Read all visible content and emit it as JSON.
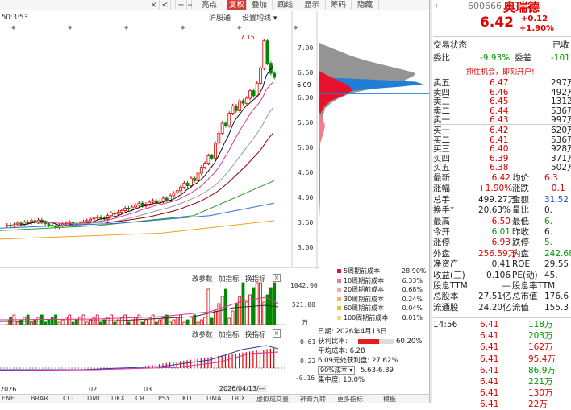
{
  "toolbar": {
    "buttons": [
      "×",
      "<",
      "|",
      "+",
      "−",
      "亮点",
      "复权",
      "叠加",
      "画线",
      "显示",
      "筹码",
      "隐藏"
    ],
    "active": "复权"
  },
  "chart_top": {
    "info": "50:3:53",
    "zt_label": "沪股通",
    "indicator_menu": "设置均线",
    "peak_label": "7.15"
  },
  "kline_ylabels": [
    "7.00",
    "6.50",
    "6.09",
    "6.00",
    "5.50",
    "5.00",
    "4.50",
    "4.00",
    "3.50",
    "3.00"
  ],
  "price_tag": "6.09",
  "chip_legend": [
    {
      "label": "5周期前成本",
      "pct": "28.90%",
      "color": "#e8112d"
    },
    {
      "label": "10周期前成本",
      "pct": "6.33%",
      "color": "#f27b8c"
    },
    {
      "label": "20周期前成本",
      "pct": "0.68%",
      "color": "#f7a8b4"
    },
    {
      "label": "30周期前成本",
      "pct": "0.24%",
      "color": "#f7b25a"
    },
    {
      "label": "60周期前成本",
      "pct": "0.04%",
      "color": "#e9c230"
    },
    {
      "label": "100周期前成本",
      "pct": "0.01%",
      "color": "#f0d88a"
    }
  ],
  "chip_info": {
    "date": "日期: 2026年4月13日",
    "profit_label": "获利比率:",
    "profit_value": "60.20%",
    "avg_cost": "平均成本: 6.28",
    "profit_at": "6.09元处获利盘: 27.62%",
    "cost_range_select": "90%成本",
    "cost_range": "5.63-6.89",
    "concentration": "集中度: 10.0%"
  },
  "vol_panel": {
    "params": "改参数",
    "add": "加指标",
    "switch": "换指标",
    "ylabels": [
      "1042.00",
      "521.00",
      "万"
    ]
  },
  "macd_panel": {
    "params": "改参数",
    "add": "加指标",
    "switch": "换指标",
    "ylabels": [
      "0.61",
      "0.22",
      "-0.16"
    ]
  },
  "bottom_axis": [
    "2026",
    "02",
    "03",
    "2026/04/13/—"
  ],
  "bottom_tabs": [
    "ENE",
    "BRAR",
    "CCI",
    "DMI",
    "DKX",
    "CR",
    "PSY",
    "KD",
    "DMA",
    "TRIX",
    "虚拟成交量",
    "神奇九转",
    "更多指标",
    "模板"
  ],
  "quote": {
    "code": "600666",
    "name": "奥瑞德",
    "price": "6.42",
    "change": "+0.12",
    "pct": "+1.90%",
    "trade_status_label": "交易状态",
    "trade_status": "已收",
    "weibi_label": "委比",
    "weibi": "-9.93%",
    "weicha_label": "委差",
    "weicha": "-101",
    "promo": "抓住机会，即刻开户!",
    "asks": [
      {
        "label": "卖五",
        "price": "6.47",
        "vol": "297万"
      },
      {
        "label": "卖四",
        "price": "6.46",
        "vol": "492万"
      },
      {
        "label": "卖三",
        "price": "6.45",
        "vol": "1312万"
      },
      {
        "label": "卖二",
        "price": "6.44",
        "vol": "536万"
      },
      {
        "label": "卖一",
        "price": "6.43",
        "vol": "997万"
      }
    ],
    "bids": [
      {
        "label": "买一",
        "price": "6.42",
        "vol": "620万"
      },
      {
        "label": "买二",
        "price": "6.41",
        "vol": "536万"
      },
      {
        "label": "买三",
        "price": "6.40",
        "vol": "928万"
      },
      {
        "label": "买四",
        "price": "6.39",
        "vol": "371万"
      },
      {
        "label": "买五",
        "price": "6.38",
        "vol": "502万"
      }
    ],
    "stats": [
      {
        "l1": "最新",
        "v1": "6.42",
        "c1": "red",
        "l2": "均价",
        "v2": "6.3",
        "c2": "red"
      },
      {
        "l1": "涨幅",
        "v1": "+1.90%",
        "c1": "red",
        "l2": "涨跌",
        "v2": "+0.1",
        "c2": "red"
      },
      {
        "l1": "总手",
        "v1": "499.27万",
        "c1": "",
        "l2": "金额",
        "v2": "31.52",
        "c2": "blue"
      },
      {
        "l1": "换手*",
        "v1": "20.63%",
        "c1": "",
        "l2": "量比",
        "v2": "0.",
        "c2": ""
      },
      {
        "l1": "最高",
        "v1": "6.50",
        "c1": "red",
        "l2": "最低",
        "v2": "6.",
        "c2": "green"
      },
      {
        "l1": "今开",
        "v1": "6.01",
        "c1": "green",
        "l2": "昨收",
        "v2": "6.",
        "c2": ""
      },
      {
        "l1": "涨停",
        "v1": "6.93",
        "c1": "red",
        "l2": "跌停",
        "v2": "5.",
        "c2": "green"
      },
      {
        "l1": "外盘",
        "v1": "256.59万",
        "c1": "red",
        "l2": "内盘",
        "v2": "242.68",
        "c2": "green"
      },
      {
        "l1": "净资产",
        "v1": "0.41",
        "c1": "",
        "l2": "ROE",
        "v2": "29.55",
        "c2": ""
      },
      {
        "l1": "收益(三)",
        "v1": "0.106",
        "c1": "",
        "l2": "PE(动)",
        "v2": "45.",
        "c2": ""
      },
      {
        "l1": "股息TTM",
        "v1": "—",
        "c1": "",
        "l2": "股息率TTM",
        "v2": "",
        "c2": ""
      },
      {
        "l1": "总股本",
        "v1": "27.51亿",
        "c1": "",
        "l2": "总市值",
        "v2": "176.6",
        "c2": ""
      },
      {
        "l1": "流通股",
        "v1": "24.20亿",
        "c1": "",
        "l2": "流值",
        "v2": "155.3",
        "c2": ""
      }
    ],
    "tape": [
      {
        "time": "14:56",
        "price": "6.41",
        "vol": "118万",
        "c": "green"
      },
      {
        "time": "",
        "price": "6.41",
        "vol": "203万",
        "c": "green"
      },
      {
        "time": "",
        "price": "6.41",
        "vol": "162万",
        "c": "red"
      },
      {
        "time": "",
        "price": "6.41",
        "vol": "95.4万",
        "c": "red"
      },
      {
        "time": "",
        "price": "6.41",
        "vol": "86.9万",
        "c": "green"
      },
      {
        "time": "",
        "price": "6.41",
        "vol": "221万",
        "c": "green"
      },
      {
        "time": "",
        "price": "6.41",
        "vol": "130万",
        "c": "red"
      },
      {
        "time": "",
        "price": "6.41",
        "vol": "22万",
        "c": "red"
      }
    ]
  }
}
